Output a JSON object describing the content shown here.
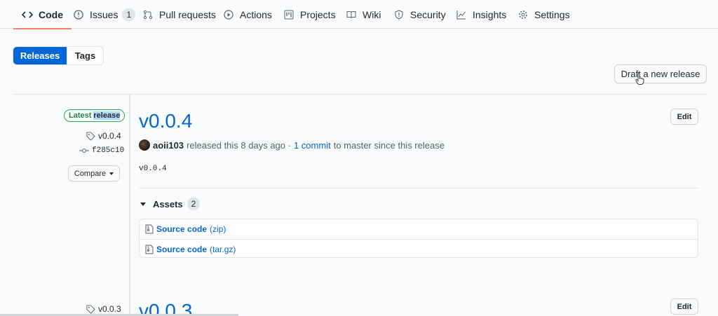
{
  "nav": {
    "tabs": [
      {
        "label": "Code",
        "icon": "code-icon",
        "active": true
      },
      {
        "label": "Issues",
        "icon": "issue-opened-icon",
        "count": "1"
      },
      {
        "label": "Pull requests",
        "icon": "git-pull-request-icon"
      },
      {
        "label": "Actions",
        "icon": "play-icon"
      },
      {
        "label": "Projects",
        "icon": "project-icon"
      },
      {
        "label": "Wiki",
        "icon": "book-icon"
      },
      {
        "label": "Security",
        "icon": "shield-icon"
      },
      {
        "label": "Insights",
        "icon": "graph-icon"
      },
      {
        "label": "Settings",
        "icon": "gear-icon"
      }
    ]
  },
  "subnav": {
    "releases_label": "Releases",
    "tags_label": "Tags"
  },
  "draft_button_label": "Draft a new release",
  "releases": [
    {
      "badge_prefix": "Latest",
      "badge_highlight": "release",
      "tag": "v0.0.4",
      "commit": "f285c10",
      "compare_label": "Compare",
      "title": "v0.0.4",
      "edit_label": "Edit",
      "author": "aoii103",
      "byline_text": "released this 8 days ago ·",
      "commits_link": "1 commit",
      "byline_suffix": "to master since this release",
      "body": "v0.0.4",
      "assets_label": "Assets",
      "assets_count": "2",
      "assets": [
        {
          "name": "Source code",
          "ext": "(zip)"
        },
        {
          "name": "Source code",
          "ext": "(tar.gz)"
        }
      ]
    },
    {
      "tag": "v0.0.3",
      "title": "v0.0.3",
      "edit_label": "Edit"
    }
  ],
  "colors": {
    "accent": "#0366d6",
    "active_tab_underline": "#f9826c",
    "latest_badge": "#28a745"
  }
}
